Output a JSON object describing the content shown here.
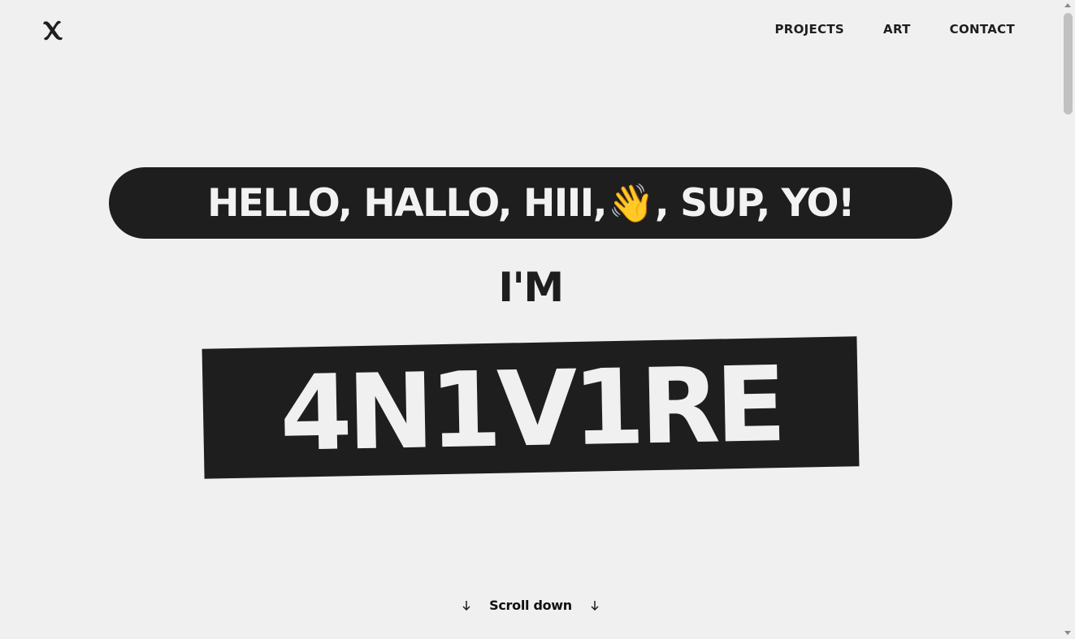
{
  "header": {
    "logo_icon": "x-logo-icon",
    "nav": [
      {
        "label": "PROJECTS"
      },
      {
        "label": "ART"
      },
      {
        "label": "CONTACT"
      }
    ]
  },
  "hero": {
    "greeting_before": "HELLO, HALLO, HIII,",
    "greeting_emoji": "👋",
    "greeting_after": ", SUP, YO!",
    "intro": "I'M",
    "name": "4N1V1RE"
  },
  "scroll": {
    "label": "Scroll down",
    "icon": "arrow-down-icon"
  },
  "colors": {
    "background": "#f0f0f0",
    "dark": "#1f1e1f",
    "light_text": "#f2f2f2"
  }
}
